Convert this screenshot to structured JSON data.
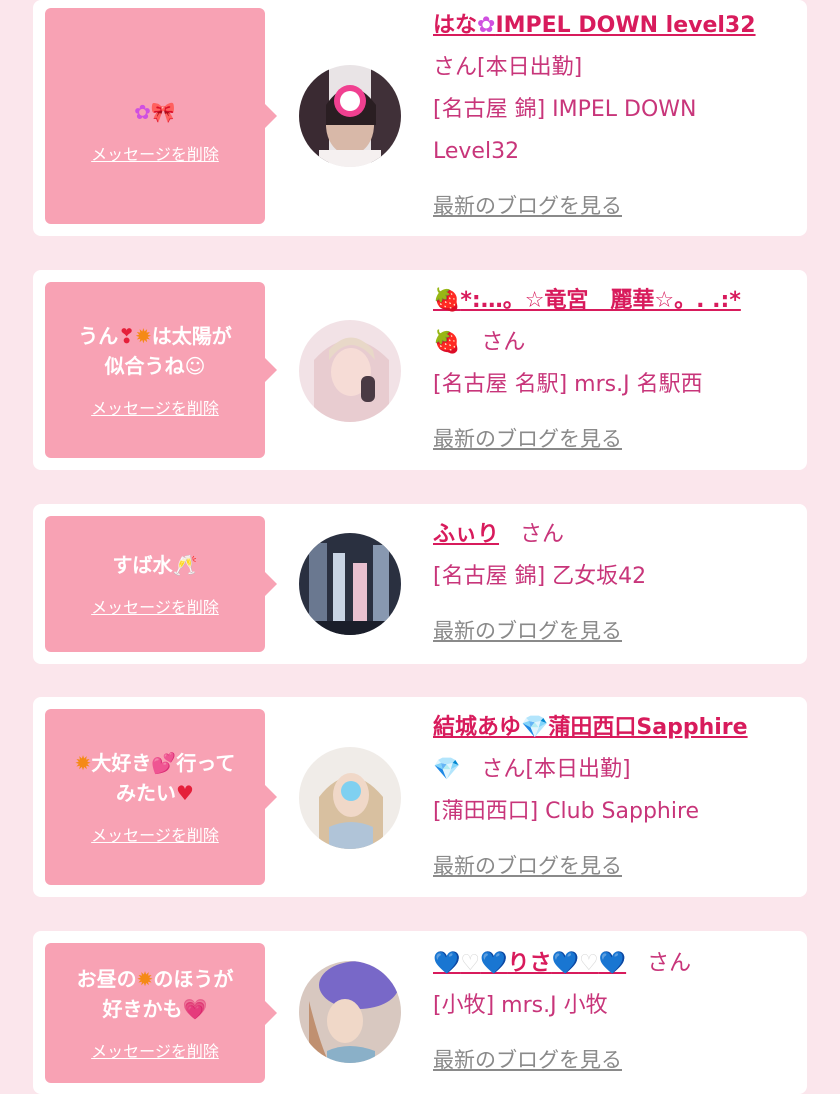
{
  "delete_label": "メッセージを削除",
  "blog_label": "最新のブログを見る",
  "san": "さん",
  "cards": [
    {
      "message_text": "",
      "name": "はな",
      "name_suffix": "IMPEL DOWN level32",
      "status": "さん[本日出勤]",
      "shop_line1": "[名古屋 錦] IMPEL DOWN",
      "shop_line2": "Level32"
    },
    {
      "message_line1_a": "うん",
      "message_line1_b": "は太陽が",
      "message_line2": "似合うね",
      "name": "*:…。☆竜宮　麗華☆。. .:*",
      "shop": "[名古屋 名駅] mrs.J 名駅西"
    },
    {
      "message_text": "すば水",
      "name": "ふぃり",
      "shop": "[名古屋 錦] 乙女坂42"
    },
    {
      "message_line1_a": "大好き",
      "message_line1_b": "行って",
      "message_line2": "みたい",
      "name": "結城あゆ",
      "name_suffix": "蒲田西口Sapphire",
      "status": "さん[本日出勤]",
      "shop": "[蒲田西口] Club Sapphire"
    },
    {
      "message_line1_a": "お昼の",
      "message_line1_b": "のほうが",
      "message_line2": "好きかも",
      "name": "りさ",
      "shop": "[小牧] mrs.J 小牧"
    }
  ],
  "colors": {
    "background": "#fbe6ec",
    "bubble": "#f8a2b4",
    "name": "#d81b5c",
    "text": "#c8357a",
    "blog_link": "#8a8a8a"
  },
  "icons": [
    "clover-icon",
    "ribbon-icon",
    "heart-icon",
    "flower-icon",
    "strawberry-icon",
    "champagne-icon",
    "gem-icon",
    "blue-heart-icon",
    "white-heart-icon"
  ]
}
